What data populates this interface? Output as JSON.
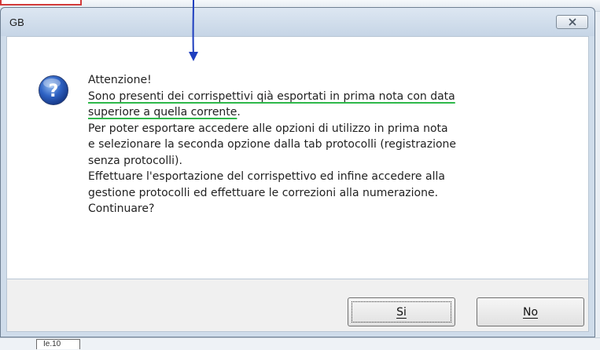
{
  "dialog": {
    "title": "GB",
    "icon": "question-icon",
    "message_lines": [
      "Attenzione!",
      "Sono presenti dei corrispettivi qià esportati in prima nota con data",
      "superiore a quella corrente",
      ".",
      "Per poter esportare accedere alle opzioni di utilizzo in prima nota",
      "e selezionare la seconda opzione dalla tab protocolli (registrazione",
      "senza protocolli).",
      "Effettuare l'esportazione del corrispettivo ed infine accedere alla",
      "gestione protocolli ed effettuare le correzioni alla numerazione.",
      "Continuare?"
    ],
    "buttons": {
      "yes": "Si",
      "no": "No"
    }
  },
  "background": {
    "cell_text": "Ie.10"
  },
  "colors": {
    "annotation_arrow": "#1f3fbf",
    "highlight_underline": "#2eb84a",
    "annotation_box": "#d23a3a"
  }
}
